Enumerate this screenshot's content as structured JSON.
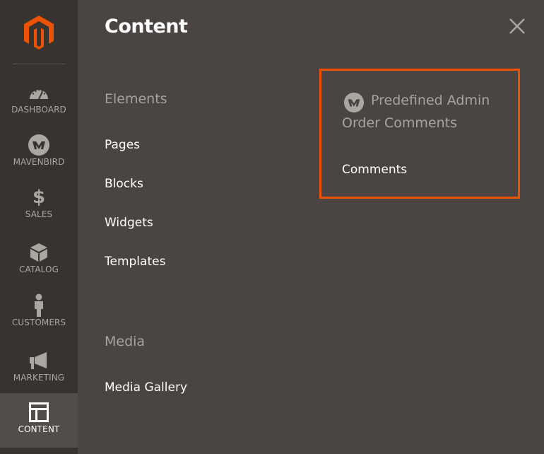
{
  "sidebar": {
    "items": [
      {
        "label": "DASHBOARD",
        "icon": "gauge-icon"
      },
      {
        "label": "MAVENBIRD",
        "icon": "mavenbird-icon"
      },
      {
        "label": "SALES",
        "icon": "dollar-icon"
      },
      {
        "label": "CATALOG",
        "icon": "box-icon"
      },
      {
        "label": "CUSTOMERS",
        "icon": "person-icon"
      },
      {
        "label": "MARKETING",
        "icon": "megaphone-icon"
      },
      {
        "label": "CONTENT",
        "icon": "layout-icon",
        "active": true
      }
    ]
  },
  "panel": {
    "title": "Content",
    "close_icon": "close-icon",
    "sections": [
      {
        "title": "Elements",
        "links": [
          "Pages",
          "Blocks",
          "Widgets",
          "Templates"
        ]
      },
      {
        "title": "Media",
        "links": [
          "Media Gallery"
        ]
      }
    ],
    "extension": {
      "title_line1": "Predefined Admin",
      "title_line2": "Order Comments",
      "links": [
        "Comments"
      ],
      "highlight_color": "#eb5202"
    }
  },
  "colors": {
    "sidebar_bg": "#373330",
    "panel_bg": "#4a4542",
    "active_bg": "#524d49",
    "brand": "#eb5202"
  }
}
